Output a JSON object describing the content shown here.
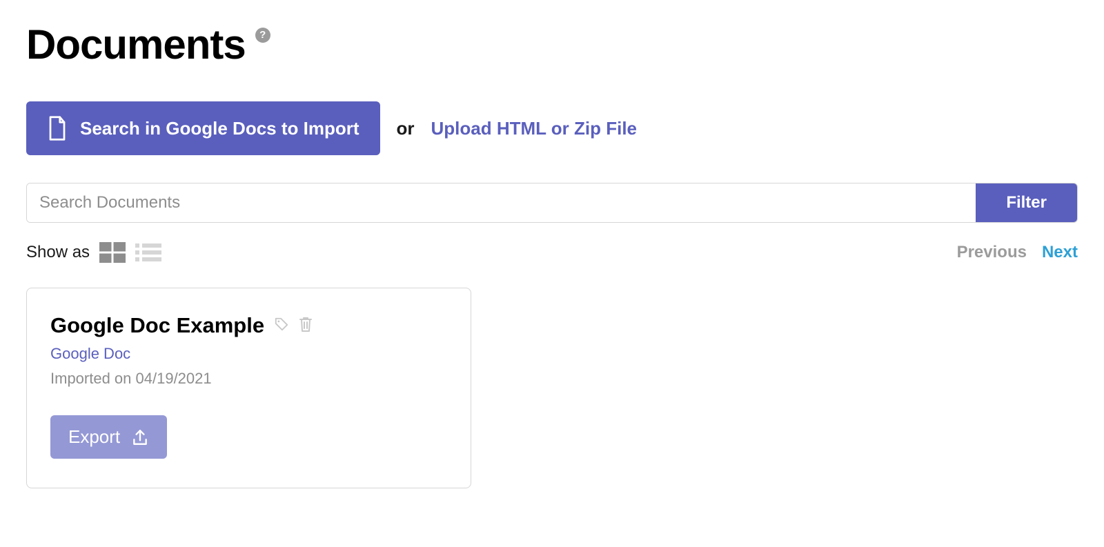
{
  "header": {
    "title": "Documents"
  },
  "actions": {
    "search_import_label": "Search in Google Docs to Import",
    "or_label": "or",
    "upload_link_label": "Upload HTML or Zip File"
  },
  "search": {
    "placeholder": "Search Documents",
    "filter_label": "Filter"
  },
  "controls": {
    "show_as_label": "Show as",
    "previous_label": "Previous",
    "next_label": "Next"
  },
  "card": {
    "title": "Google Doc Example",
    "source_label": "Google Doc",
    "imported_label": "Imported on 04/19/2021",
    "export_label": "Export"
  }
}
